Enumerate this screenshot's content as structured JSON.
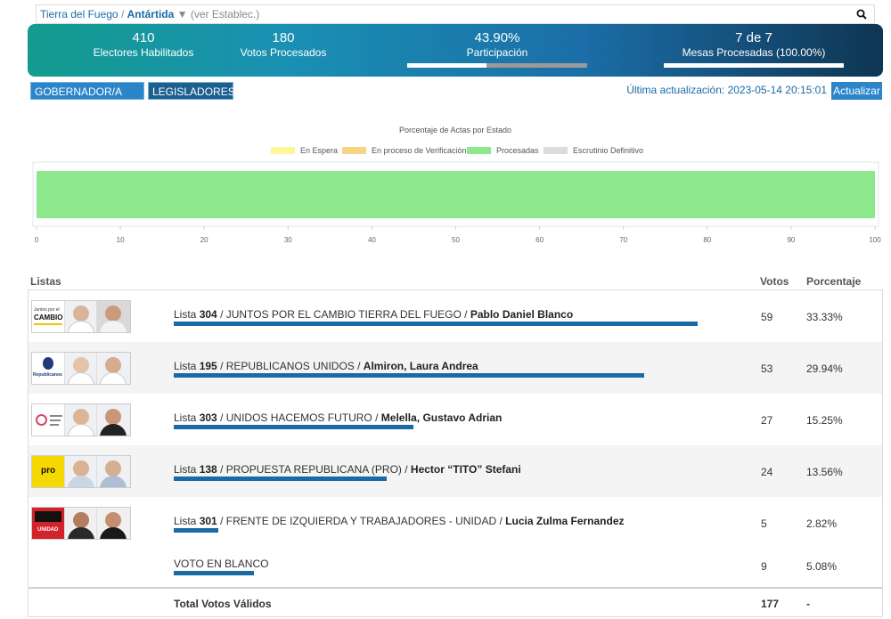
{
  "breadcrumb": {
    "province": "Tierra del Fuego",
    "separator": "/",
    "department": "Antártida",
    "caret": "▼",
    "hint": "(ver Establec.)"
  },
  "summary": {
    "electores_value": "410",
    "electores_label": "Electores Habilitados",
    "votos_value": "180",
    "votos_label": "Votos Procesados",
    "participacion_value": "43.90%",
    "participacion_label": "Participación",
    "participacion_fraction": 0.439,
    "mesas_value": "7 de 7",
    "mesas_label": "Mesas Procesadas (100.00%)",
    "mesas_fraction": 1.0
  },
  "tabs": [
    {
      "label": "GOBERNADOR/A VICE"
    },
    {
      "label": "LEGISLADORES"
    }
  ],
  "update": {
    "text": "Última actualización: 2023-05-14 20:15:01",
    "button_label": "Actualizar"
  },
  "chart_data": {
    "type": "bar",
    "title": "Porcentaje de Actas por Estado",
    "categories": [
      ""
    ],
    "series": [
      {
        "name": "En Espera",
        "color": "#fff59a",
        "values": [
          0
        ]
      },
      {
        "name": "En proceso de Verificación",
        "color": "#f8d487",
        "values": [
          0
        ]
      },
      {
        "name": "Procesadas",
        "color": "#8de88d",
        "values": [
          100
        ]
      },
      {
        "name": "Escrutinio Definitivo",
        "color": "#dcdcdc",
        "values": [
          0
        ]
      }
    ],
    "orientation": "horizontal",
    "stacked": true,
    "xlim": [
      0,
      100
    ],
    "xticks": [
      0,
      10,
      20,
      30,
      40,
      50,
      60,
      70,
      80,
      90,
      100
    ],
    "legend": "top"
  },
  "table": {
    "header_listas": "Listas",
    "header_votos": "Votos",
    "header_pct": "Porcentaje",
    "rows": [
      {
        "lista_word": "Lista",
        "number": "304",
        "party": "JUNTOS POR EL CAMBIO TIERRA DEL FUEGO",
        "candidate": "Pablo Daniel Blanco",
        "votes": "59",
        "pct": "33.33%",
        "fraction": 0.3333,
        "logo_text": "CAMBIO"
      },
      {
        "lista_word": "Lista",
        "number": "195",
        "party": "REPUBLICANOS UNIDOS",
        "candidate": "Almiron, Laura Andrea",
        "votes": "53",
        "pct": "29.94%",
        "fraction": 0.2994,
        "logo_text": "Republicanos"
      },
      {
        "lista_word": "Lista",
        "number": "303",
        "party": "UNIDOS HACEMOS FUTURO",
        "candidate": "Melella, Gustavo Adrian",
        "votes": "27",
        "pct": "15.25%",
        "fraction": 0.1525,
        "logo_text": ""
      },
      {
        "lista_word": "Lista",
        "number": "138",
        "party": "PROPUESTA REPUBLICANA (PRO)",
        "candidate": "Hector “TITO” Stefani",
        "votes": "24",
        "pct": "13.56%",
        "fraction": 0.1356,
        "logo_text": "pro"
      },
      {
        "lista_word": "Lista",
        "number": "301",
        "party": "FRENTE DE IZQUIERDA Y TRABAJADORES - UNIDAD",
        "candidate": "Lucia Zulma Fernandez",
        "votes": "5",
        "pct": "2.82%",
        "fraction": 0.0282,
        "logo_text": "UNIDAD"
      }
    ],
    "blank": {
      "label": "VOTO EN BLANCO",
      "votes": "9",
      "pct": "5.08%",
      "fraction": 0.0508
    },
    "total": {
      "label": "Total Votos Válidos",
      "votes": "177",
      "pct": "-"
    }
  }
}
